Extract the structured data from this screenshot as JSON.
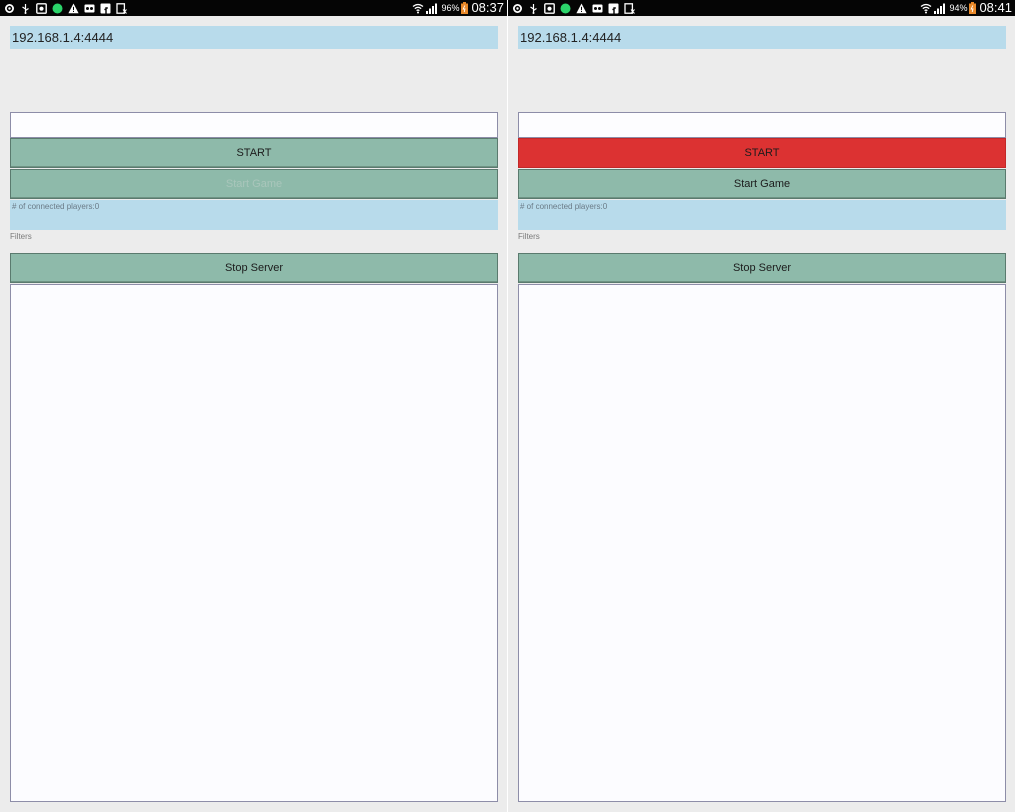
{
  "screens": [
    {
      "status_bar": {
        "icons": [
          "settings-icon",
          "usb-icon",
          "screenshot-icon",
          "circle-app-icon",
          "warning-icon",
          "voicemail-icon",
          "facebook-icon",
          "clipboard-icon"
        ],
        "battery_percent": "96%",
        "time": "08:37"
      },
      "server_address": "192.168.1.4:4444",
      "text_field_value": "",
      "start_button_label": "START",
      "start_button_state": "normal",
      "start_game_label": "Start Game",
      "start_game_state": "disabled",
      "connected_players": "# of connected players:0",
      "filters_label": "Filters",
      "stop_server_label": "Stop Server"
    },
    {
      "status_bar": {
        "icons": [
          "settings-icon",
          "usb-icon",
          "screenshot-icon",
          "circle-app-icon",
          "warning-icon",
          "voicemail-icon",
          "facebook-icon",
          "clipboard-icon"
        ],
        "battery_percent": "94%",
        "time": "08:41"
      },
      "server_address": "192.168.1.4:4444",
      "text_field_value": "",
      "start_button_label": "START",
      "start_button_state": "active",
      "start_game_label": "Start Game",
      "start_game_state": "enabled",
      "connected_players": "# of connected players:0",
      "filters_label": "Filters",
      "stop_server_label": "Stop Server"
    }
  ],
  "colors": {
    "background": "#ececec",
    "status_bar": "#050505",
    "info_panel": "#b8dbeb",
    "button": "#8ebaaa",
    "start_active": "#dc3232",
    "field": "#fdfdff"
  }
}
